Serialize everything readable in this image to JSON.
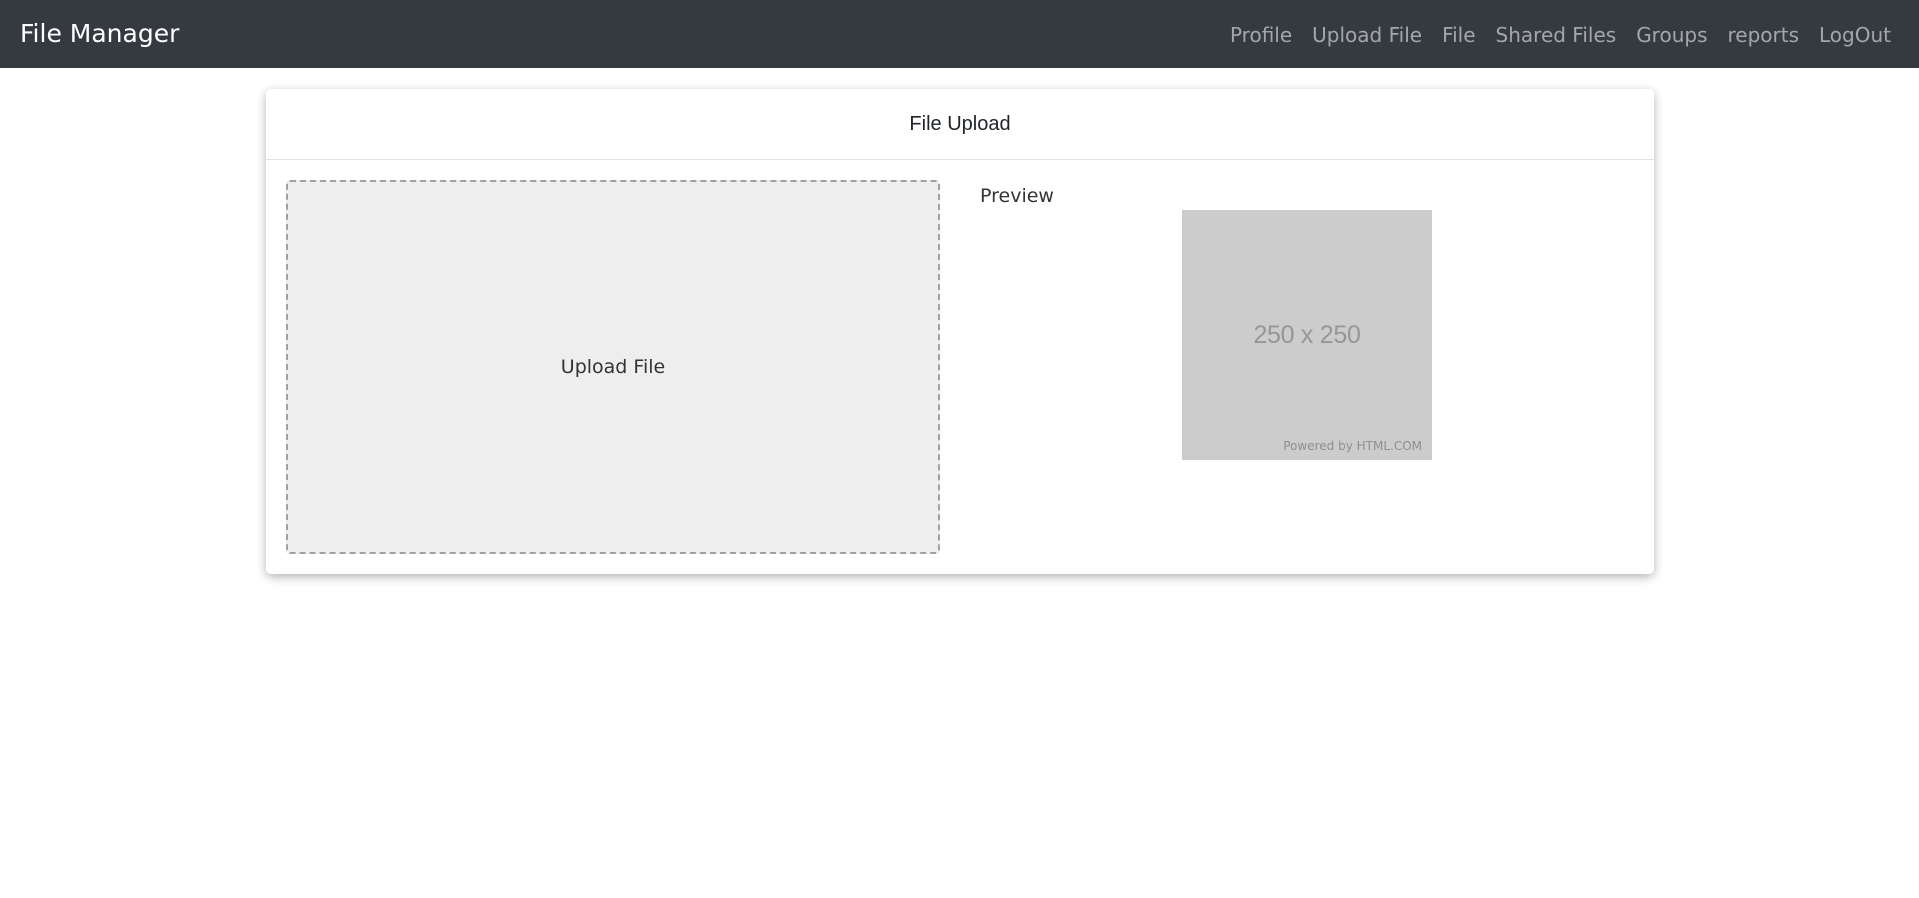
{
  "navbar": {
    "brand": "File Manager",
    "links": [
      {
        "label": "Profile"
      },
      {
        "label": "Upload File"
      },
      {
        "label": "File"
      },
      {
        "label": "Shared Files"
      },
      {
        "label": "Groups"
      },
      {
        "label": "reports"
      },
      {
        "label": "LogOut"
      }
    ]
  },
  "card": {
    "title": "File Upload",
    "dropzone_label": "Upload File",
    "preview_label": "Preview",
    "preview_image": {
      "size_text": "250 x 250",
      "powered_text": "Powered by HTML.COM"
    }
  },
  "colors": {
    "navbar_bg": "#343a40",
    "dropzone_bg": "#eeeeee",
    "placeholder_bg": "#cccccc"
  }
}
